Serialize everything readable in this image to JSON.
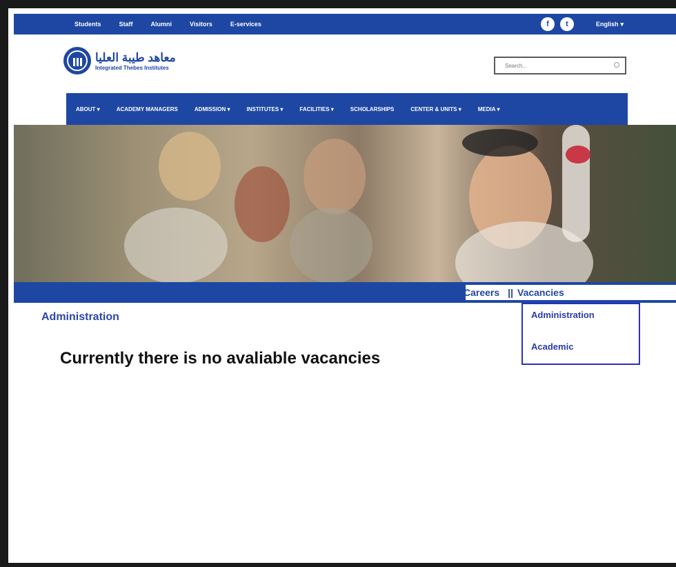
{
  "topbar": {
    "links": [
      "Students",
      "Staff",
      "Alumni",
      "Visitors",
      "E-services"
    ],
    "social": [
      "f",
      "t"
    ],
    "language": "English"
  },
  "logo": {
    "arabic": "معاهد طيبة العليا",
    "english": "Integrated Thebes Institutes"
  },
  "search": {
    "placeholder": "Search..."
  },
  "nav": {
    "items": [
      "ABOUT",
      "ACADEMY MANAGERS",
      "ADMISSION",
      "INSTITUTES",
      "FACILITIES",
      "SCHOLARSHIPS",
      "CENTER & UNITS",
      "MEDIA"
    ]
  },
  "breadcrumb": {
    "careers": "Careers",
    "separator": "||",
    "vacancies": "Vacancies"
  },
  "vacancies_menu": {
    "options": [
      "Administration",
      "Academic"
    ]
  },
  "content": {
    "section_title": "Administration",
    "message": "Currently there is no avaliable vacancies"
  },
  "colors": {
    "brand_blue": "#1e47a3",
    "menu_border": "#2b2fbf"
  }
}
